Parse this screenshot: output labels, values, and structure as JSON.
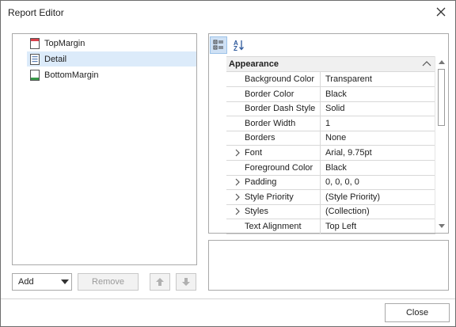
{
  "window": {
    "title": "Report Editor",
    "close_icon": "close-icon"
  },
  "bands": [
    {
      "label": "TopMargin",
      "icon": "top-margin-band-icon",
      "color": "#d9414b",
      "selected": false
    },
    {
      "label": "Detail",
      "icon": "detail-band-icon",
      "color": "#5b7fb5",
      "selected": true
    },
    {
      "label": "BottomMargin",
      "icon": "bottom-margin-band-icon",
      "color": "#3a9a4a",
      "selected": false
    }
  ],
  "controls": {
    "add_label": "Add",
    "remove_label": "Remove",
    "move_up_icon": "arrow-up-icon",
    "move_down_icon": "arrow-down-icon"
  },
  "property_grid": {
    "toolbar": {
      "categorized_icon": "categorized-icon",
      "alphabetical_icon": "sort-alphabetical-icon"
    },
    "category": "Appearance",
    "rows": [
      {
        "name": "Background Color",
        "value": "Transparent",
        "expandable": false
      },
      {
        "name": "Border Color",
        "value": "Black",
        "expandable": false
      },
      {
        "name": "Border Dash Style",
        "value": "Solid",
        "expandable": false
      },
      {
        "name": "Border Width",
        "value": "1",
        "expandable": false
      },
      {
        "name": "Borders",
        "value": "None",
        "expandable": false
      },
      {
        "name": "Font",
        "value": "Arial, 9.75pt",
        "expandable": true
      },
      {
        "name": "Foreground Color",
        "value": "Black",
        "expandable": false
      },
      {
        "name": "Padding",
        "value": "0, 0, 0, 0",
        "expandable": true
      },
      {
        "name": "Style Priority",
        "value": "(Style Priority)",
        "expandable": true
      },
      {
        "name": "Styles",
        "value": "(Collection)",
        "expandable": true
      },
      {
        "name": "Text Alignment",
        "value": "Top Left",
        "expandable": false
      }
    ]
  },
  "footer": {
    "close_label": "Close"
  },
  "colors": {
    "selection": "#dcebfa",
    "toolbar_active": "#cfe1f5",
    "border": "#a9a9a9"
  }
}
